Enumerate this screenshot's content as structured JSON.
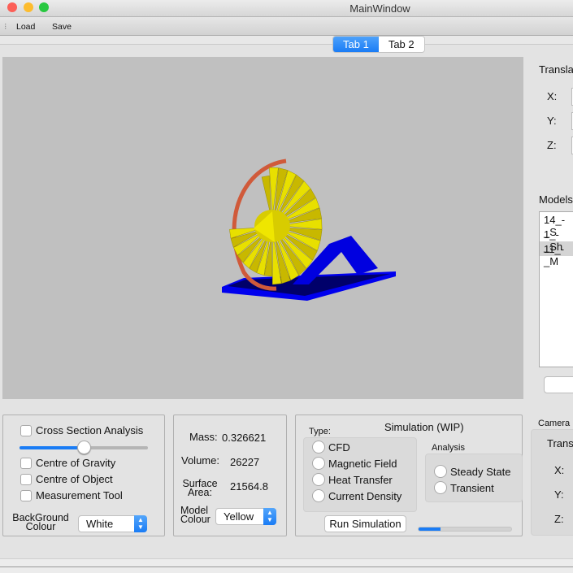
{
  "window": {
    "title": "MainWindow"
  },
  "toolbar": {
    "load": "Load",
    "save": "Save"
  },
  "tabs": [
    {
      "label": "Tab 1"
    },
    {
      "label": "Tab 2"
    }
  ],
  "right_panel": {
    "translate_label": "Transla",
    "x": "X:",
    "y": "Y:",
    "z": "Z:",
    "models_label": "Models",
    "models": [
      "14_-_S",
      "1_-_Sh",
      "11_-_M"
    ]
  },
  "display": {
    "cross_section": "Cross Section Analysis",
    "slider_value": 0.5,
    "centre_gravity": "Centre of Gravity",
    "centre_object": "Centre of Object",
    "measurement": "Measurement Tool",
    "bg_label_1": "BackGround",
    "bg_label_2": "Colour",
    "bg_value": "White"
  },
  "properties": {
    "mass_label": "Mass:",
    "mass": "0.326621",
    "volume_label": "Volume:",
    "volume": "26227",
    "surface_label_1": "Surface",
    "surface_label_2": "Area:",
    "surface": "21564.8",
    "model_label_1": "Model",
    "model_label_2": "Colour",
    "model_colour": "Yellow"
  },
  "simulation": {
    "title": "Simulation (WIP)",
    "type_label": "Type:",
    "types": [
      "CFD",
      "Magnetic Field",
      "Heat Transfer",
      "Current Density"
    ],
    "analysis_label": "Analysis",
    "analysis": [
      "Steady State",
      "Transient"
    ],
    "run": "Run Simulation",
    "progress": 0.24
  },
  "camera": {
    "label": "Camera",
    "trans": "Trans",
    "x": "X:",
    "y": "Y:",
    "z": "Z:"
  },
  "colors": {
    "accent": "#1a7cf5",
    "viewport": "#c0c0c0",
    "model": "#e8e000",
    "base": "#0000ee",
    "ring": "#d05a3a"
  }
}
